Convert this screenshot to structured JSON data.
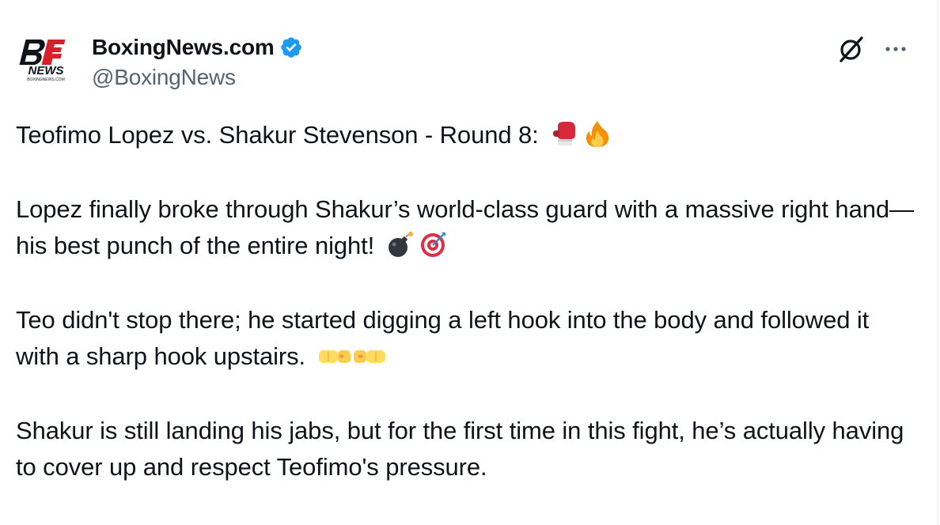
{
  "account": {
    "display_name": "BoxingNews.com",
    "handle": "@BoxingNews",
    "avatar_logo_text": "BN",
    "avatar_sub_text": "NEWS",
    "avatar_tiny_text": "BOXINGNEWS.COM",
    "verified": true
  },
  "toolbar": {
    "grok_icon": "grok-icon",
    "more_icon": "more-icon"
  },
  "post": {
    "paragraphs": [
      {
        "text": "Teofimo Lopez vs. Shakur Stevenson - Round 8:",
        "emojis": [
          "boxing-glove-icon",
          "fire-icon"
        ]
      },
      {
        "text": "Lopez finally broke through Shakur’s world-class guard with a massive right hand—his best punch of the entire night!",
        "emojis": [
          "bomb-icon",
          "direct-hit-icon"
        ]
      },
      {
        "text": "Teo didn't stop there; he started digging a left hook into the body and followed it with a sharp hook upstairs.",
        "emojis": [
          "left-fist-icon",
          "right-fist-icon"
        ]
      },
      {
        "text": "Shakur is still landing his jabs, but for the first time in this fight, he’s actually having to cover up and respect Teofimo's pressure.",
        "emojis": []
      }
    ]
  },
  "colors": {
    "text_primary": "#0f1419",
    "text_secondary": "#536471",
    "verified_blue": "#1d9bf0",
    "logo_red": "#d8202a"
  }
}
